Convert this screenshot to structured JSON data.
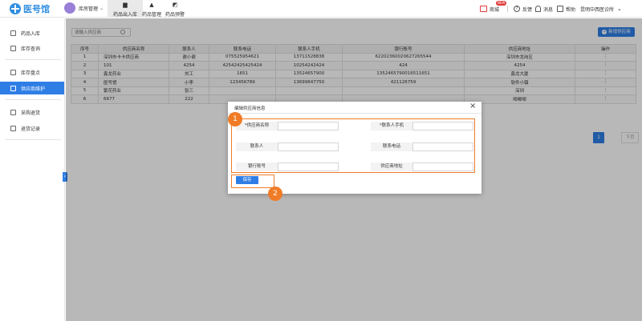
{
  "brand": {
    "name": "医号馆"
  },
  "user": {
    "label": "库房管理"
  },
  "nav_tabs": [
    {
      "label": "药品出入库",
      "icon": "folder-icon",
      "active": true
    },
    {
      "label": "药品管理",
      "icon": "flask-icon",
      "active": false
    },
    {
      "label": "药品预警",
      "icon": "alert-icon",
      "active": false
    }
  ],
  "top_right": {
    "mall": "商城",
    "new_badge": "NEW",
    "feedback": "反馈",
    "messages": "消息",
    "help": "帮助",
    "clinic": "昆明中西医诊所"
  },
  "sidebar": {
    "items": [
      {
        "label": "药品入库",
        "icon": "home-icon"
      },
      {
        "label": "库存查询",
        "icon": "box-icon"
      },
      {
        "label": "库存盘点",
        "icon": "clipboard-icon"
      },
      {
        "label": "供应商维护",
        "icon": "supplier-icon",
        "active": true
      },
      {
        "label": "采购退货",
        "icon": "return-icon"
      },
      {
        "label": "退货记录",
        "icon": "record-icon"
      }
    ]
  },
  "toolbar": {
    "search_placeholder": "请输入供应商",
    "add_button": "新增供应商"
  },
  "table": {
    "headers": [
      "序号",
      "供应商名称",
      "联系人",
      "联系电话",
      "联系人手机",
      "银行账号",
      "供应商地址",
      "操作"
    ],
    "rows": [
      [
        "1",
        "深圳市卡卡供应商",
        "谢小谢",
        "075525954621",
        "13711528838",
        "62202360020627265544",
        "深圳市龙岗区",
        "⋮"
      ],
      [
        "2",
        "101",
        "4254",
        "42542425425424",
        "10254242424",
        "424",
        "4254",
        "⋮"
      ],
      [
        "3",
        "鑫龙药业",
        "刘工",
        "1651",
        "13524657900",
        "1352465790016511651",
        "鑫龙大厦",
        "⋮"
      ],
      [
        "4",
        "医号馆",
        "小李",
        "123456789",
        "13699647750",
        "421126759",
        "软件小镇",
        "⋮"
      ],
      [
        "5",
        "繁花药业",
        "张三",
        "",
        "",
        "",
        "深圳",
        "⋮"
      ],
      [
        "6",
        "6677",
        "222",
        "",
        "",
        "",
        "唧唧唧",
        "⋮"
      ]
    ]
  },
  "pagination": {
    "current": "1",
    "next": "下页"
  },
  "modal": {
    "title": "编辑供应商信息",
    "close": "×",
    "fields": [
      {
        "label": "*供应商名称",
        "value": ""
      },
      {
        "label": "*联系人手机",
        "value": ""
      },
      {
        "label": "联系人",
        "value": ""
      },
      {
        "label": "联系电话",
        "value": ""
      },
      {
        "label": "银行账号",
        "value": ""
      },
      {
        "label": "供应商地址",
        "value": ""
      }
    ],
    "save": "保存"
  },
  "annotations": {
    "step1": "1",
    "step2": "2"
  },
  "colors": {
    "accent": "#2f7ee6",
    "annotation": "#f07c27",
    "mall": "#e23a3a"
  }
}
